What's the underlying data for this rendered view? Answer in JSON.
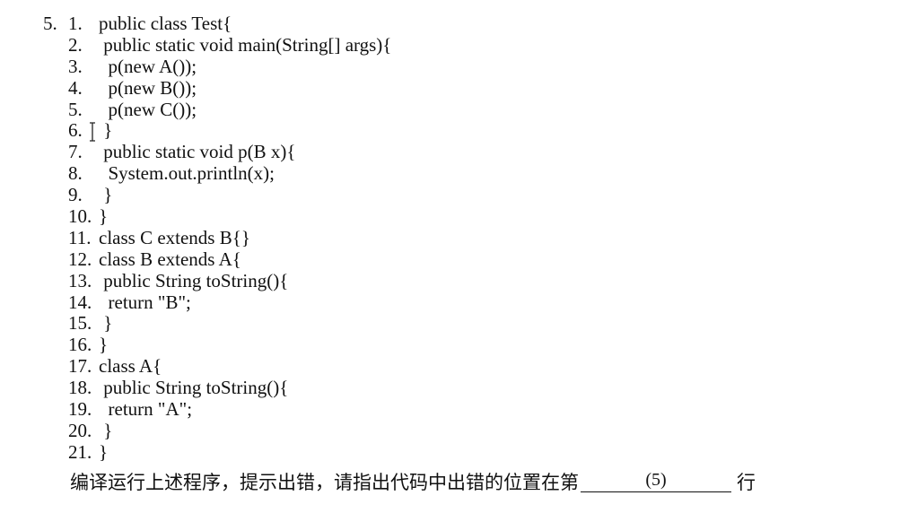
{
  "question": {
    "number": "5.",
    "code_lines": [
      {
        "num": "1.",
        "text": "public class Test{"
      },
      {
        "num": "2.",
        "text": " public static void main(String[] args){"
      },
      {
        "num": "3.",
        "text": "  p(new A());"
      },
      {
        "num": "4.",
        "text": "  p(new B());"
      },
      {
        "num": "5.",
        "text": "  p(new C());"
      },
      {
        "num": "6.",
        "text": " }"
      },
      {
        "num": "7.",
        "text": " public static void p(B x){"
      },
      {
        "num": "8.",
        "text": "  System.out.println(x);"
      },
      {
        "num": "9.",
        "text": " }"
      },
      {
        "num": "10.",
        "text": "}"
      },
      {
        "num": "11.",
        "text": "class C extends B{}"
      },
      {
        "num": "12.",
        "text": "class B extends A{"
      },
      {
        "num": "13.",
        "text": " public String toString(){"
      },
      {
        "num": "14.",
        "text": "  return \"B\";"
      },
      {
        "num": "15.",
        "text": " }"
      },
      {
        "num": "16.",
        "text": "}"
      },
      {
        "num": "17.",
        "text": "class A{"
      },
      {
        "num": "18.",
        "text": " public String toString(){"
      },
      {
        "num": "19.",
        "text": "  return \"A\";"
      },
      {
        "num": "20.",
        "text": " }"
      },
      {
        "num": "21.",
        "text": "}"
      }
    ],
    "prompt_before": "编译运行上述程序，提示出错，请指出代码中出错的位置在第",
    "blank_label": "(5)",
    "prompt_after": "行"
  },
  "cursor_icon": "text-cursor-icon"
}
